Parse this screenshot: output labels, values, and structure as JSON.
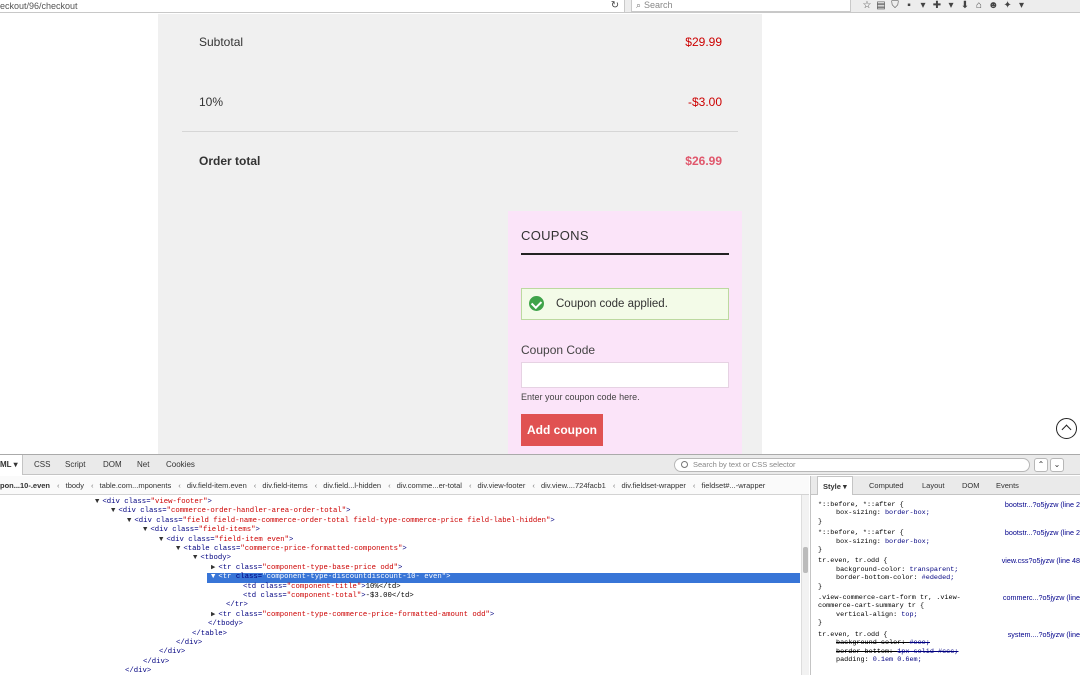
{
  "browser": {
    "url": "eckout/96/checkout",
    "search_placeholder": "Search",
    "reload_glyph": "↻",
    "search_glyph": "⌕",
    "toolbar_icons": [
      "☆",
      "▤",
      "⛉",
      "▪",
      "▾",
      "✚",
      "▾",
      "⬇",
      "⌂",
      "☻",
      "✦",
      "▾"
    ]
  },
  "order": {
    "subtotal_label": "Subtotal",
    "subtotal_value": "$29.99",
    "discount_label": "10%",
    "discount_value": "-$3.00",
    "total_label": "Order total",
    "total_value": "$26.99",
    "total_color": "#e0566b"
  },
  "coupons": {
    "title": "COUPONS",
    "success_message": "Coupon code applied.",
    "field_label": "Coupon Code",
    "field_value": "",
    "field_help": "Enter your coupon code here.",
    "button_label": "Add coupon",
    "button_color": "#e05252",
    "panel_color": "#fbe4f9"
  },
  "devtools": {
    "tabs": [
      "ML ▾",
      "CSS",
      "Script",
      "DOM",
      "Net",
      "Cookies"
    ],
    "search_placeholder": "Search by text or CSS selector",
    "nav_up": "⌃",
    "nav_down": "⌄",
    "crumbs": [
      "pon...10-.even",
      "tbody",
      "table.com...mponents",
      "div.field-item.even",
      "div.field-items",
      "div.field...l-hidden",
      "div.comme...er-total",
      "div.view-footer",
      "div.view....724facb1",
      "div.fieldset-wrapper",
      "fieldset#...-wrapper"
    ],
    "dom_lines": [
      {
        "tw": "▼",
        "open": "<div ",
        "attr": "class=",
        "val": "\"view-footer\"",
        "close": ">",
        "text": ""
      },
      {
        "tw": "▼",
        "open": "<div ",
        "attr": "class=",
        "val": "\"commerce-order-handler-area-order-total\"",
        "close": ">",
        "text": ""
      },
      {
        "tw": "▼",
        "open": "<div ",
        "attr": "class=",
        "val": "\"field field-name-commerce-order-total field-type-commerce-price field-label-hidden\"",
        "close": ">",
        "text": ""
      },
      {
        "tw": "▼",
        "open": "<div ",
        "attr": "class=",
        "val": "\"field-items\"",
        "close": ">",
        "text": ""
      },
      {
        "tw": "▼",
        "open": "<div ",
        "attr": "class=",
        "val": "\"field-item even\"",
        "close": ">",
        "text": ""
      },
      {
        "tw": "▼",
        "open": "<table ",
        "attr": "class=",
        "val": "\"commerce-price-formatted-components\"",
        "close": ">",
        "text": ""
      },
      {
        "tw": "▼",
        "open": "<tbody>",
        "attr": "",
        "val": "",
        "close": "",
        "text": ""
      },
      {
        "tw": "▶",
        "open": "<tr ",
        "attr": "class=",
        "val": "\"component-type-base-price odd\"",
        "close": ">",
        "text": ""
      },
      {
        "tw": "▼",
        "open": "<tr ",
        "attr": "class=",
        "val": "\"component-type-discountdiscount-10- even\"",
        "close": ">",
        "text": ""
      },
      {
        "tw": "",
        "open": "<td ",
        "attr": "class=",
        "val": "\"component-title\"",
        "close": ">",
        "text": "10%</td>"
      },
      {
        "tw": "",
        "open": "<td ",
        "attr": "class=",
        "val": "\"component-total\"",
        "close": ">",
        "text": "-$3.00</td>"
      },
      {
        "tw": "",
        "open": "</tr>",
        "attr": "",
        "val": "",
        "close": "",
        "text": ""
      },
      {
        "tw": "▶",
        "open": "<tr ",
        "attr": "class=",
        "val": "\"component-type-commerce-price-formatted-amount odd\"",
        "close": ">",
        "text": ""
      },
      {
        "tw": "",
        "open": "</tbody>",
        "attr": "",
        "val": "",
        "close": "",
        "text": ""
      },
      {
        "tw": "",
        "open": "</table>",
        "attr": "",
        "val": "",
        "close": "",
        "text": ""
      },
      {
        "tw": "",
        "open": "</div>",
        "attr": "",
        "val": "",
        "close": "",
        "text": ""
      },
      {
        "tw": "",
        "open": "</div>",
        "attr": "",
        "val": "",
        "close": "",
        "text": ""
      },
      {
        "tw": "",
        "open": "</div>",
        "attr": "",
        "val": "",
        "close": "",
        "text": ""
      },
      {
        "tw": "",
        "open": "</div>",
        "attr": "",
        "val": "",
        "close": "",
        "text": ""
      }
    ],
    "side_tabs": [
      "Style ▾",
      "Computed",
      "Layout",
      "DOM",
      "Events"
    ],
    "rules": [
      {
        "selector": "*::before, *::after {",
        "source": "bootstr...?o5jyzw (line 2",
        "props": [
          {
            "name": "box-sizing",
            "value": "border-box;",
            "strike": false
          }
        ]
      },
      {
        "selector": "*::before, *::after {",
        "source": "bootstr...?o5jyzw (line 2",
        "props": [
          {
            "name": "box-sizing",
            "value": "border-box;",
            "strike": false
          }
        ]
      },
      {
        "selector": "tr.even, tr.odd {",
        "source": "view.css?o5jyzw (line 48",
        "props": [
          {
            "name": "background-color",
            "value": "transparent;",
            "strike": false
          },
          {
            "name": "border-bottom-color",
            "value": "#ededed;",
            "strike": false
          }
        ]
      },
      {
        "selector": ".view-commerce-cart-form tr, .view-\ncommerce-cart-summary tr {",
        "source": "commerc...?o5jyzw (line",
        "props": [
          {
            "name": "vertical-align",
            "value": "top;",
            "strike": false
          }
        ]
      },
      {
        "selector": "tr.even, tr.odd {",
        "source": "system....?o5jyzw (line",
        "props": [
          {
            "name": "background-color",
            "value": "#eee;",
            "strike": true
          },
          {
            "name": "border-bottom",
            "value": "1px solid #ccc;",
            "strike": true
          },
          {
            "name": "padding",
            "value": "0.1em 0.6em;",
            "strike": false
          }
        ]
      }
    ]
  }
}
